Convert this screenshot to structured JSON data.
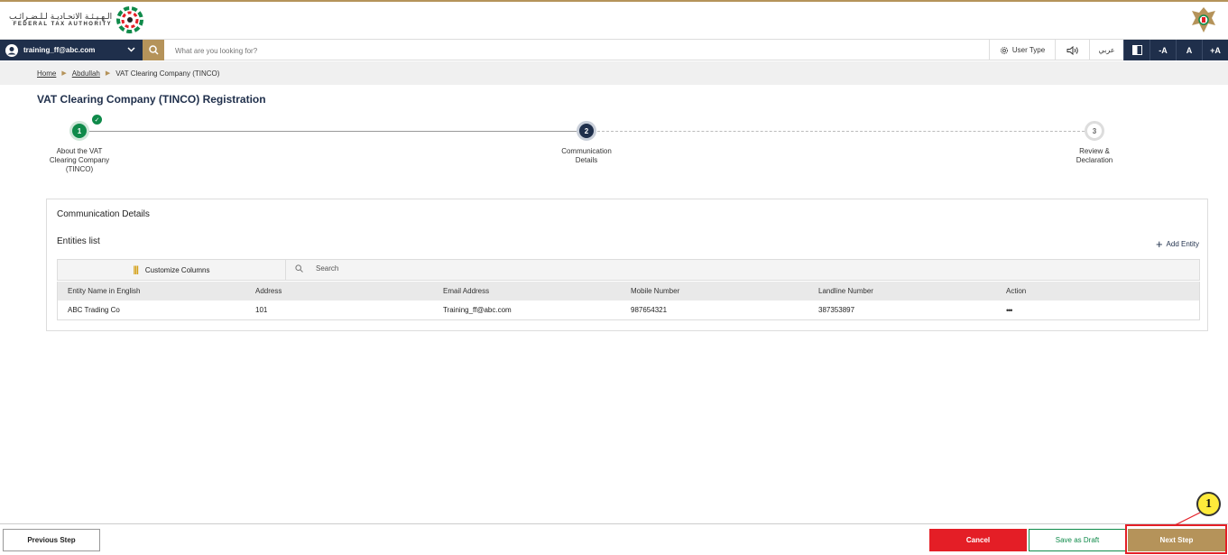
{
  "header": {
    "logo_ar": "الـهـيـئـة الاتحـاديـة لـلـضـرائـب",
    "logo_en": "FEDERAL TAX AUTHORITY"
  },
  "navbar": {
    "user_email": "training_ff@abc.com",
    "search_placeholder": "What are you looking for?",
    "user_type_label": "User Type",
    "language_label": "عربي",
    "font_decrease": "-A",
    "font_normal": "A",
    "font_increase": "+A"
  },
  "breadcrumb": {
    "home": "Home",
    "user": "Abdullah",
    "current": "VAT Clearing Company (TINCO)"
  },
  "page": {
    "title": "VAT Clearing Company (TINCO) Registration"
  },
  "stepper": {
    "steps": [
      {
        "number": "1",
        "label_lines": [
          "About the VAT",
          "Clearing Company",
          "(TINCO)"
        ],
        "status": "completed"
      },
      {
        "number": "2",
        "label_lines": [
          "Communication",
          "Details"
        ],
        "status": "active"
      },
      {
        "number": "3",
        "label_lines": [
          "Review &",
          "Declaration"
        ],
        "status": "pending"
      }
    ]
  },
  "card": {
    "title": "Communication Details",
    "entities_title": "Entities list",
    "add_entity_label": "Add Entity",
    "customize_columns_label": "Customize Columns",
    "search_placeholder": "Search",
    "columns": [
      "Entity Name in English",
      "Address",
      "Email Address",
      "Mobile Number",
      "Landline Number",
      "Action"
    ],
    "rows": [
      {
        "name": "ABC Trading Co",
        "address": "101",
        "email": "Training_ff@abc.com",
        "mobile": "987654321",
        "landline": "387353897",
        "action": "•••"
      }
    ]
  },
  "footer": {
    "previous_label": "Previous Step",
    "cancel_label": "Cancel",
    "draft_label": "Save as Draft",
    "next_label": "Next Step"
  },
  "annotation": {
    "callout_number": "1"
  },
  "colors": {
    "navy": "#1f2f4b",
    "gold": "#b5935a",
    "green": "#0f8a4a",
    "red": "#e41e26"
  }
}
